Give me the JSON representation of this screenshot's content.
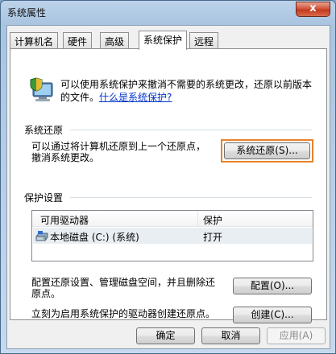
{
  "window": {
    "title": "系统属性",
    "close_glyph": "x"
  },
  "tabs": [
    {
      "label": "计算机名"
    },
    {
      "label": "硬件"
    },
    {
      "label": "高级"
    },
    {
      "label": "系统保护",
      "active": true
    },
    {
      "label": "远程"
    }
  ],
  "intro": {
    "text": "可以使用系统保护来撤消不需要的系统更改，还原以前版本的文件。",
    "link": "什么是系统保护?"
  },
  "system_restore": {
    "group_label": "系统还原",
    "description_line1": "可以通过将计算机还原到上一个还原点，",
    "description_line2": "撤消系统更改。",
    "button": "系统还原(S)..."
  },
  "protection": {
    "group_label": "保护设置",
    "columns": [
      "可用驱动器",
      "保护"
    ],
    "rows": [
      {
        "drive": "本地磁盘 (C:) (系统)",
        "protection": "打开"
      }
    ],
    "configure_text_line1": "配置还原设置、管理磁盘空间，并且删除还",
    "configure_text_line2": "原点。",
    "configure_button": "配置(O)...",
    "create_text": "立刻为启用系统保护的驱动器创建还原点。",
    "create_button": "创建(C)..."
  },
  "footer": {
    "ok": "确定",
    "cancel": "取消",
    "apply": "应用(A)"
  },
  "colors": {
    "highlight": "#e8822a",
    "link": "#0033cc"
  },
  "icons": {
    "close": "close-icon",
    "system_protection": "shield-computer-icon",
    "drive": "drive-icon"
  }
}
